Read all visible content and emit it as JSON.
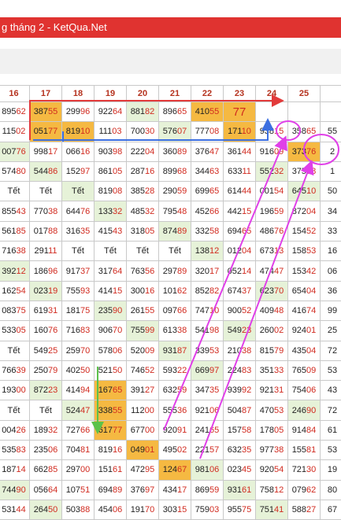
{
  "header": {
    "title": "g tháng 2 - KetQua.Net"
  },
  "columns": [
    "16",
    "17",
    "18",
    "19",
    "20",
    "21",
    "22",
    "23",
    "24",
    "25",
    ""
  ],
  "rows": [
    [
      {
        "v": "89562"
      },
      {
        "v": "38755",
        "h": 1
      },
      {
        "v": "29996"
      },
      {
        "v": "92264"
      },
      {
        "v": "88182",
        "g": 1
      },
      {
        "v": "89665"
      },
      {
        "v": "41055",
        "h": 1
      },
      {
        "v": "77",
        "h": 1,
        "big": 1
      },
      {
        "v": ""
      },
      {
        "v": ""
      },
      {
        "v": ""
      }
    ],
    [
      {
        "v": "11502"
      },
      {
        "v": "05177",
        "h": 1
      },
      {
        "v": "81910",
        "h": 1
      },
      {
        "v": "11103"
      },
      {
        "v": "70030"
      },
      {
        "v": "57607",
        "g": 1
      },
      {
        "v": "77708"
      },
      {
        "v": "17110",
        "h": 1
      },
      {
        "v": "93815"
      },
      {
        "v": "35865"
      },
      {
        "v": "55"
      }
    ],
    [
      {
        "v": "00776",
        "g": 1
      },
      {
        "v": "99817"
      },
      {
        "v": "06616"
      },
      {
        "v": "90398"
      },
      {
        "v": "22204"
      },
      {
        "v": "36089"
      },
      {
        "v": "37647"
      },
      {
        "v": "36144"
      },
      {
        "v": "91609"
      },
      {
        "v": "37376",
        "h": 1
      },
      {
        "v": "2"
      }
    ],
    [
      {
        "v": "57480"
      },
      {
        "v": "54486",
        "g": 1
      },
      {
        "v": "15297"
      },
      {
        "v": "86105"
      },
      {
        "v": "28716"
      },
      {
        "v": "89968"
      },
      {
        "v": "34463"
      },
      {
        "v": "63311"
      },
      {
        "v": "55232",
        "g": 1
      },
      {
        "v": "37568"
      },
      {
        "v": "1"
      }
    ],
    [
      {
        "v": "Tết"
      },
      {
        "v": "Tết"
      },
      {
        "v": "Tết",
        "g": 1
      },
      {
        "v": "81908"
      },
      {
        "v": "38528"
      },
      {
        "v": "29059"
      },
      {
        "v": "69965"
      },
      {
        "v": "61444"
      },
      {
        "v": "00154"
      },
      {
        "v": "64510",
        "g": 1
      },
      {
        "v": "50"
      }
    ],
    [
      {
        "v": "85543"
      },
      {
        "v": "77038"
      },
      {
        "v": "64476"
      },
      {
        "v": "13332",
        "g": 1
      },
      {
        "v": "48532"
      },
      {
        "v": "79548"
      },
      {
        "v": "45266"
      },
      {
        "v": "44215"
      },
      {
        "v": "19659"
      },
      {
        "v": "87204"
      },
      {
        "v": "34"
      }
    ],
    [
      {
        "v": "56185"
      },
      {
        "v": "01788"
      },
      {
        "v": "31635"
      },
      {
        "v": "41543"
      },
      {
        "v": "31805"
      },
      {
        "v": "87489",
        "g": 1
      },
      {
        "v": "33258"
      },
      {
        "v": "69465"
      },
      {
        "v": "48676"
      },
      {
        "v": "15452"
      },
      {
        "v": "33"
      }
    ],
    [
      {
        "v": "71638"
      },
      {
        "v": "29111"
      },
      {
        "v": "Tết"
      },
      {
        "v": "Tết"
      },
      {
        "v": "Tết"
      },
      {
        "v": "Tết"
      },
      {
        "v": "13812",
        "g": 1
      },
      {
        "v": "01204"
      },
      {
        "v": "67313"
      },
      {
        "v": "15853"
      },
      {
        "v": "16"
      }
    ],
    [
      {
        "v": "39212",
        "g": 1
      },
      {
        "v": "18696"
      },
      {
        "v": "91737"
      },
      {
        "v": "31764"
      },
      {
        "v": "76356"
      },
      {
        "v": "29789"
      },
      {
        "v": "32017"
      },
      {
        "v": "05214"
      },
      {
        "v": "47447"
      },
      {
        "v": "15342"
      },
      {
        "v": "06"
      }
    ],
    [
      {
        "v": "16254"
      },
      {
        "v": "02319",
        "g": 1
      },
      {
        "v": "75593"
      },
      {
        "v": "41415"
      },
      {
        "v": "30016"
      },
      {
        "v": "10162"
      },
      {
        "v": "85282"
      },
      {
        "v": "67437"
      },
      {
        "v": "62370",
        "g": 1
      },
      {
        "v": "65404"
      },
      {
        "v": "36"
      }
    ],
    [
      {
        "v": "08375"
      },
      {
        "v": "61931"
      },
      {
        "v": "18175"
      },
      {
        "v": "23590",
        "g": 1
      },
      {
        "v": "26155"
      },
      {
        "v": "09766"
      },
      {
        "v": "74710"
      },
      {
        "v": "90052"
      },
      {
        "v": "40948"
      },
      {
        "v": "41674"
      },
      {
        "v": "99"
      }
    ],
    [
      {
        "v": "53305"
      },
      {
        "v": "16076"
      },
      {
        "v": "71683"
      },
      {
        "v": "90670"
      },
      {
        "v": "75599",
        "g": 1
      },
      {
        "v": "61338"
      },
      {
        "v": "54198"
      },
      {
        "v": "54923",
        "g": 1
      },
      {
        "v": "26002"
      },
      {
        "v": "92401"
      },
      {
        "v": "25"
      }
    ],
    [
      {
        "v": "Tết"
      },
      {
        "v": "54925"
      },
      {
        "v": "25970"
      },
      {
        "v": "57806"
      },
      {
        "v": "52009"
      },
      {
        "v": "93187",
        "g": 1
      },
      {
        "v": "33953"
      },
      {
        "v": "21038"
      },
      {
        "v": "81579"
      },
      {
        "v": "43504"
      },
      {
        "v": "72"
      }
    ],
    [
      {
        "v": "76639"
      },
      {
        "v": "25079"
      },
      {
        "v": "40250"
      },
      {
        "v": "52150"
      },
      {
        "v": "74652"
      },
      {
        "v": "59322"
      },
      {
        "v": "66997",
        "g": 1
      },
      {
        "v": "22483"
      },
      {
        "v": "35133"
      },
      {
        "v": "76509"
      },
      {
        "v": "53"
      }
    ],
    [
      {
        "v": "19300"
      },
      {
        "v": "87223",
        "g": 1
      },
      {
        "v": "41494"
      },
      {
        "v": "16765",
        "h": 1
      },
      {
        "v": "39127"
      },
      {
        "v": "63259"
      },
      {
        "v": "34735"
      },
      {
        "v": "93992"
      },
      {
        "v": "92131"
      },
      {
        "v": "75406"
      },
      {
        "v": "43"
      }
    ],
    [
      {
        "v": "Tết"
      },
      {
        "v": "Tết"
      },
      {
        "v": "52447",
        "g": 1
      },
      {
        "v": "33855",
        "h": 1
      },
      {
        "v": "11200"
      },
      {
        "v": "55536"
      },
      {
        "v": "92106"
      },
      {
        "v": "50487"
      },
      {
        "v": "47053"
      },
      {
        "v": "24690",
        "g": 1
      },
      {
        "v": "72"
      }
    ],
    [
      {
        "v": "00426"
      },
      {
        "v": "18932"
      },
      {
        "v": "72766"
      },
      {
        "v": "61777",
        "h": 1
      },
      {
        "v": "67700"
      },
      {
        "v": "92091"
      },
      {
        "v": "24165"
      },
      {
        "v": "15758"
      },
      {
        "v": "17805"
      },
      {
        "v": "91484"
      },
      {
        "v": "61"
      }
    ],
    [
      {
        "v": "53583"
      },
      {
        "v": "23506"
      },
      {
        "v": "70481"
      },
      {
        "v": "81916"
      },
      {
        "v": "04901",
        "h": 1
      },
      {
        "v": "49502"
      },
      {
        "v": "22157"
      },
      {
        "v": "63235"
      },
      {
        "v": "97738"
      },
      {
        "v": "15581"
      },
      {
        "v": "53"
      }
    ],
    [
      {
        "v": "18714"
      },
      {
        "v": "66285"
      },
      {
        "v": "29700"
      },
      {
        "v": "15161"
      },
      {
        "v": "47295"
      },
      {
        "v": "12467",
        "h": 1
      },
      {
        "v": "98106",
        "g": 1
      },
      {
        "v": "02345"
      },
      {
        "v": "92054"
      },
      {
        "v": "72130"
      },
      {
        "v": "19"
      }
    ],
    [
      {
        "v": "74490",
        "g": 1
      },
      {
        "v": "05664"
      },
      {
        "v": "10751"
      },
      {
        "v": "69489"
      },
      {
        "v": "37697"
      },
      {
        "v": "43417"
      },
      {
        "v": "86959"
      },
      {
        "v": "93161",
        "g": 1
      },
      {
        "v": "75812"
      },
      {
        "v": "07962"
      },
      {
        "v": "80"
      }
    ],
    [
      {
        "v": "53144"
      },
      {
        "v": "26450",
        "g": 1
      },
      {
        "v": "50388"
      },
      {
        "v": "45406"
      },
      {
        "v": "19170"
      },
      {
        "v": "30315"
      },
      {
        "v": "75903"
      },
      {
        "v": "95575"
      },
      {
        "v": "75141",
        "g": 1
      },
      {
        "v": "58827"
      },
      {
        "v": "67"
      }
    ]
  ],
  "colors": {
    "highlight": "#f5b942",
    "green": "#e6f2d8",
    "red_bar": "#e03330",
    "digits_red": "#d12a1f"
  },
  "annotations": {
    "note_number": "77"
  }
}
